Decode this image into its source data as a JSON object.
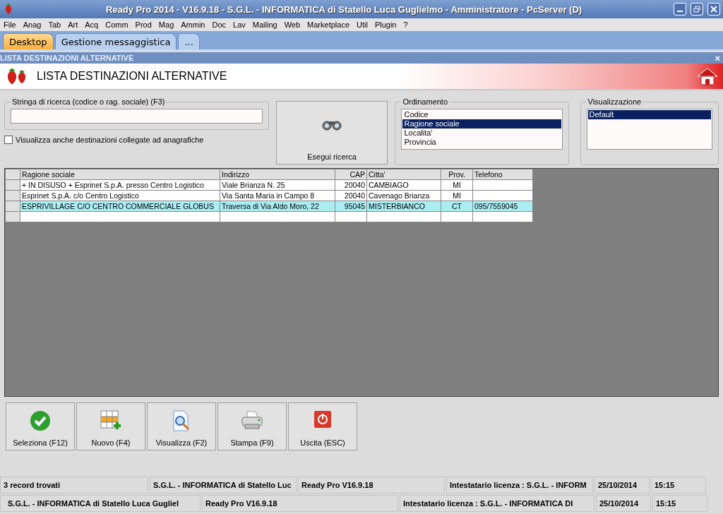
{
  "window": {
    "title": "Ready Pro 2014 - V16.9.18 - S.G.L. - INFORMATICA di Statello Luca Guglielmo - Amministratore - PcServer (D)"
  },
  "menu": [
    "File",
    "Anag",
    "Tab",
    "Art",
    "Acq",
    "Comm",
    "Prod",
    "Mag",
    "Ammin",
    "Doc",
    "Lav",
    "Mailing",
    "Web",
    "Marketplace",
    "Util",
    "Plugin",
    "?"
  ],
  "tabs": [
    {
      "label": "Desktop",
      "selected": true
    },
    {
      "label": "Gestione messaggistica",
      "selected": false
    },
    {
      "label": "...",
      "selected": false
    }
  ],
  "subwindow": {
    "title": "LISTA DESTINAZIONI ALTERNATIVE",
    "close": "×"
  },
  "header": {
    "title": "LISTA DESTINAZIONI ALTERNATIVE"
  },
  "search": {
    "label": "Stringa di ricerca (codice o rag. sociale) (F3)",
    "button": "Esegui ricerca"
  },
  "checkbox": {
    "label": "Visualizza anche destinazioni collegate ad anagrafiche",
    "checked": false
  },
  "ordinamento": {
    "label": "Ordinamento",
    "items": [
      {
        "label": "Codice",
        "selected": false
      },
      {
        "label": "Ragione sociale",
        "selected": true
      },
      {
        "label": "Localita'",
        "selected": false
      },
      {
        "label": "Provincia",
        "selected": false
      }
    ]
  },
  "visualizzazione": {
    "label": "Visualizzazione",
    "items": [
      {
        "label": "Default",
        "selected": true
      }
    ]
  },
  "table": {
    "columns": [
      "Ragione sociale",
      "Indirizzo",
      "CAP",
      "Citta'",
      "Prov.",
      "Telefono"
    ],
    "rows": [
      {
        "cells": [
          "+ IN DISUSO + Esprinet S.p.A. presso Centro Logistico",
          "Viale Brianza N. 25",
          "20040",
          "CAMBIAGO",
          "MI",
          ""
        ],
        "selected": false
      },
      {
        "cells": [
          "Esprinet S.p.A. c/o Centro Logistico",
          "Via Santa Maria in Campo 8",
          "20040",
          "Cavenago Brianza",
          "MI",
          ""
        ],
        "selected": false
      },
      {
        "cells": [
          "ESPRIVILLAGE C/O CENTRO COMMERCIALE GLOBUS",
          "Traversa di Via Aldo Moro, 22",
          "95045",
          "MISTERBIANCO",
          "CT",
          "095/7559045"
        ],
        "selected": true
      },
      {
        "cells": [
          "",
          "",
          "",
          "",
          "",
          ""
        ],
        "selected": false
      }
    ]
  },
  "buttons": [
    "Seleziona (F12)",
    "Nuovo (F4)",
    "Visualizza (F2)",
    "Stampa (F9)",
    "Uscita (ESC)"
  ],
  "status_bar_1": [
    "3 record trovati",
    "S.G.L. - INFORMATICA di Statello Luc",
    "Ready Pro V16.9.18",
    "Intestatario licenza : S.G.L. - INFORM",
    "25/10/2014",
    "15:15"
  ],
  "status_bar_2": [
    "S.G.L. - INFORMATICA di Statello Luca Gugliel",
    "Ready Pro V16.9.18",
    "Intestatario licenza : S.G.L. - INFORMATICA DI",
    "25/10/2014",
    "15:15"
  ]
}
